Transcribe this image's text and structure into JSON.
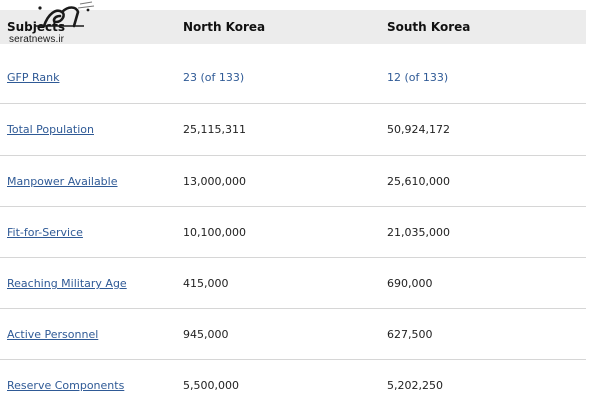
{
  "table": {
    "headers": {
      "subject": "Subjects",
      "north_korea": "North Korea",
      "south_korea": "South Korea"
    },
    "rows": [
      {
        "subject": "GFP Rank",
        "north_korea": "23 (of 133)",
        "south_korea": "12 (of 133)"
      },
      {
        "subject": "Total Population",
        "north_korea": "25,115,311",
        "south_korea": "50,924,172"
      },
      {
        "subject": "Manpower Available",
        "north_korea": "13,000,000",
        "south_korea": "25,610,000"
      },
      {
        "subject": "Fit-for-Service",
        "north_korea": "10,100,000",
        "south_korea": "21,035,000"
      },
      {
        "subject": "Reaching Military Age",
        "north_korea": "415,000",
        "south_korea": "690,000"
      },
      {
        "subject": "Active Personnel",
        "north_korea": "945,000",
        "south_korea": "627,500"
      },
      {
        "subject": "Reserve Components",
        "north_korea": "5,500,000",
        "south_korea": "5,202,250"
      }
    ]
  },
  "watermark": {
    "url": "seratnews.ir"
  },
  "colors": {
    "header_bg": "#ececec",
    "link": "#2f5a96",
    "divider": "#d6d6d6"
  }
}
